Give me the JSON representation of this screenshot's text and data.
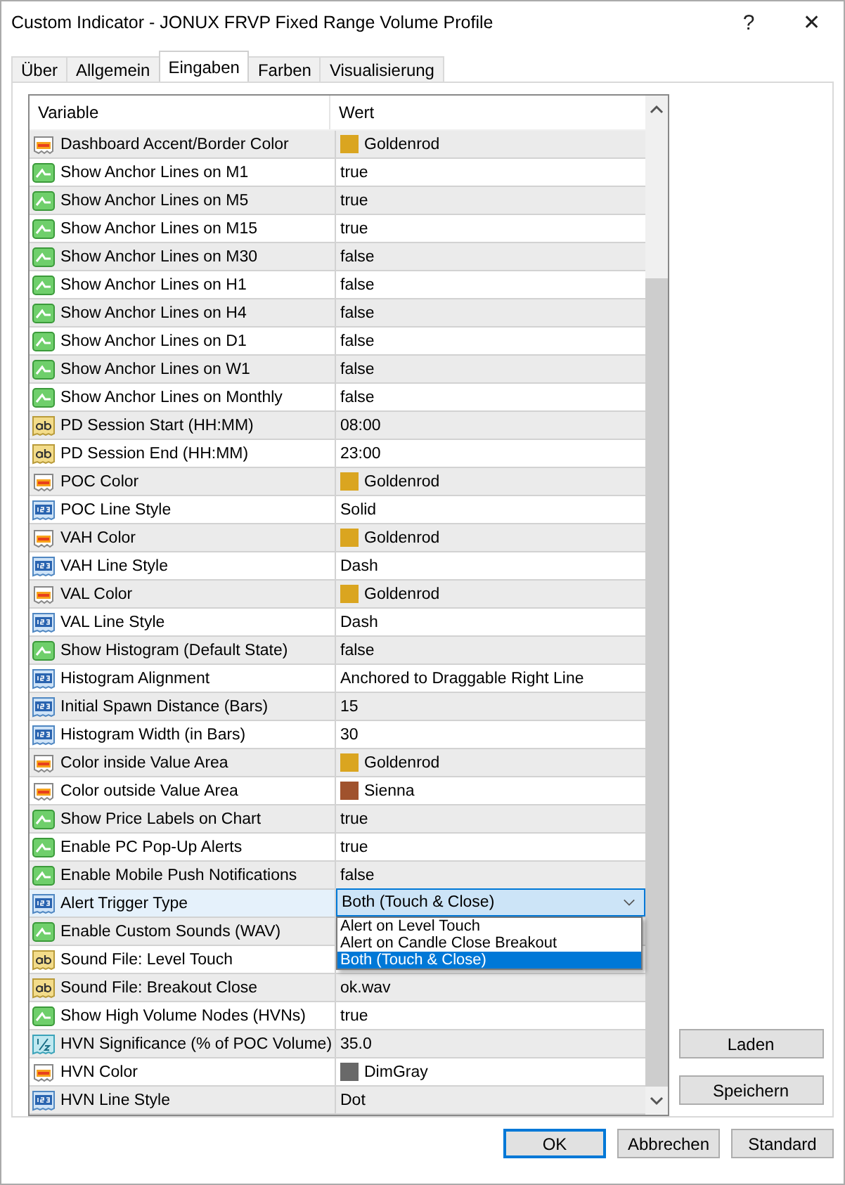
{
  "window": {
    "title": "Custom Indicator - JONUX FRVP Fixed Range Volume Profile",
    "help": "?",
    "close": "✕"
  },
  "tabs": [
    {
      "label": "Über",
      "selected": false
    },
    {
      "label": "Allgemein",
      "selected": false
    },
    {
      "label": "Eingaben",
      "selected": true
    },
    {
      "label": "Farben",
      "selected": false
    },
    {
      "label": "Visualisierung",
      "selected": false
    }
  ],
  "table": {
    "columns": [
      "Variable",
      "Wert"
    ],
    "rows": [
      {
        "kind": "color",
        "variable": "Dashboard Accent/Border Color",
        "value": "Goldenrod",
        "color": "#daa520",
        "selected": false
      },
      {
        "kind": "bool",
        "variable": "Show Anchor Lines on M1",
        "value": "true",
        "selected": false
      },
      {
        "kind": "bool",
        "variable": "Show Anchor Lines on M5",
        "value": "true",
        "selected": false
      },
      {
        "kind": "bool",
        "variable": "Show Anchor Lines on M15",
        "value": "true",
        "selected": false
      },
      {
        "kind": "bool",
        "variable": "Show Anchor Lines on M30",
        "value": "false",
        "selected": false
      },
      {
        "kind": "bool",
        "variable": "Show Anchor Lines on H1",
        "value": "false",
        "selected": false
      },
      {
        "kind": "bool",
        "variable": "Show Anchor Lines on H4",
        "value": "false",
        "selected": false
      },
      {
        "kind": "bool",
        "variable": "Show Anchor Lines on D1",
        "value": "false",
        "selected": false
      },
      {
        "kind": "bool",
        "variable": "Show Anchor Lines on W1",
        "value": "false",
        "selected": false
      },
      {
        "kind": "bool",
        "variable": "Show Anchor Lines on Monthly",
        "value": "false",
        "selected": false
      },
      {
        "kind": "string",
        "variable": "PD Session Start (HH:MM)",
        "value": "08:00",
        "selected": false
      },
      {
        "kind": "string",
        "variable": "PD Session End (HH:MM)",
        "value": "23:00",
        "selected": false
      },
      {
        "kind": "color",
        "variable": "POC Color",
        "value": "Goldenrod",
        "color": "#daa520",
        "selected": false
      },
      {
        "kind": "enum",
        "variable": "POC Line Style",
        "value": "Solid",
        "selected": false
      },
      {
        "kind": "color",
        "variable": "VAH Color",
        "value": "Goldenrod",
        "color": "#daa520",
        "selected": false
      },
      {
        "kind": "enum",
        "variable": "VAH Line Style",
        "value": "Dash",
        "selected": false
      },
      {
        "kind": "color",
        "variable": "VAL Color",
        "value": "Goldenrod",
        "color": "#daa520",
        "selected": false
      },
      {
        "kind": "enum",
        "variable": "VAL Line Style",
        "value": "Dash",
        "selected": false
      },
      {
        "kind": "bool",
        "variable": "Show Histogram (Default State)",
        "value": "false",
        "selected": false
      },
      {
        "kind": "enum",
        "variable": "Histogram Alignment",
        "value": "Anchored to Draggable Right Line",
        "selected": false
      },
      {
        "kind": "enum",
        "variable": "Initial Spawn Distance (Bars)",
        "value": "15",
        "selected": false
      },
      {
        "kind": "enum",
        "variable": "Histogram Width (in Bars)",
        "value": "30",
        "selected": false
      },
      {
        "kind": "color",
        "variable": "Color inside Value Area",
        "value": "Goldenrod",
        "color": "#daa520",
        "selected": false
      },
      {
        "kind": "color",
        "variable": "Color outside Value Area",
        "value": "Sienna",
        "color": "#a0522d",
        "selected": false
      },
      {
        "kind": "bool",
        "variable": "Show Price Labels on Chart",
        "value": "true",
        "selected": false
      },
      {
        "kind": "bool",
        "variable": "Enable PC Pop-Up Alerts",
        "value": "true",
        "selected": false
      },
      {
        "kind": "bool",
        "variable": "Enable Mobile Push Notifications",
        "value": "false",
        "selected": false
      },
      {
        "kind": "enum",
        "variable": "Alert Trigger Type",
        "value": "Both (Touch & Close)",
        "selected": true,
        "dropdown": {
          "options": [
            {
              "label": "Alert on Level Touch",
              "selected": false
            },
            {
              "label": "Alert on Candle Close Breakout",
              "selected": false
            },
            {
              "label": "Both (Touch & Close)",
              "selected": true
            }
          ]
        }
      },
      {
        "kind": "bool",
        "variable": "Enable Custom Sounds (WAV)",
        "selected": false
      },
      {
        "kind": "string",
        "variable": "Sound File: Level Touch",
        "selected": false
      },
      {
        "kind": "string",
        "variable": "Sound File: Breakout Close",
        "value": "ok.wav",
        "selected": false
      },
      {
        "kind": "bool",
        "variable": "Show High Volume Nodes (HVNs)",
        "value": "true",
        "selected": false
      },
      {
        "kind": "double",
        "variable": "HVN Significance (% of POC Volume)",
        "value": "35.0",
        "selected": false
      },
      {
        "kind": "color",
        "variable": "HVN Color",
        "value": "DimGray",
        "color": "#696969",
        "selected": false
      },
      {
        "kind": "enum",
        "variable": "HVN Line Style",
        "value": "Dot",
        "selected": false
      }
    ]
  },
  "side_buttons": [
    "Laden",
    "Speichern"
  ],
  "buttons": [
    {
      "label": "OK",
      "default": true
    },
    {
      "label": "Abbrechen",
      "default": false
    },
    {
      "label": "Standard",
      "default": false
    }
  ]
}
